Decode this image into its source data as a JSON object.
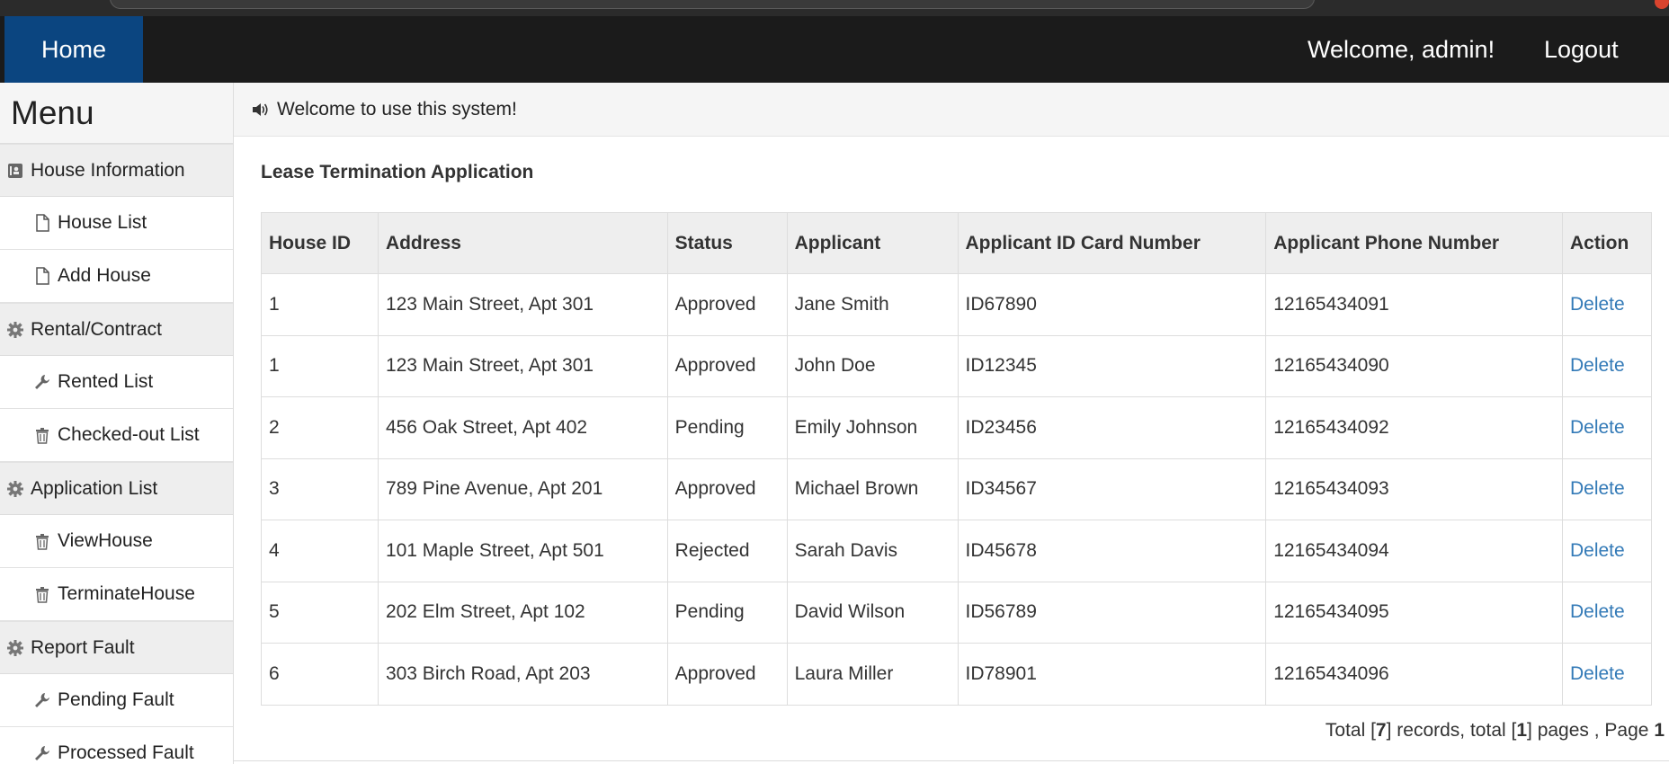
{
  "nav": {
    "home_label": "Home",
    "welcome_text": "Welcome, admin!",
    "logout_label": "Logout"
  },
  "sidebar": {
    "title": "Menu",
    "groups": [
      {
        "label": "House Information",
        "icon": "address-card-icon",
        "items": [
          {
            "label": "House List",
            "icon": "file-icon"
          },
          {
            "label": "Add House",
            "icon": "file-icon"
          }
        ]
      },
      {
        "label": "Rental/Contract",
        "icon": "gear-icon",
        "items": [
          {
            "label": "Rented List",
            "icon": "wrench-icon"
          },
          {
            "label": "Checked-out List",
            "icon": "trash-icon"
          }
        ]
      },
      {
        "label": "Application List",
        "icon": "gear-icon",
        "items": [
          {
            "label": "ViewHouse",
            "icon": "trash-icon"
          },
          {
            "label": "TerminateHouse",
            "icon": "trash-icon"
          }
        ]
      },
      {
        "label": "Report Fault",
        "icon": "gear-icon",
        "items": [
          {
            "label": "Pending Fault",
            "icon": "wrench-icon"
          },
          {
            "label": "Processed Fault",
            "icon": "wrench-icon"
          }
        ]
      }
    ]
  },
  "notice": {
    "text": "Welcome to use this system!",
    "icon": "speaker-icon"
  },
  "main": {
    "title": "Lease Termination Application",
    "columns": [
      "House ID",
      "Address",
      "Status",
      "Applicant",
      "Applicant ID Card Number",
      "Applicant Phone Number",
      "Action"
    ],
    "rows": [
      {
        "house_id": "1",
        "address": "123 Main Street, Apt 301",
        "status": "Approved",
        "applicant": "Jane Smith",
        "id_card": "ID67890",
        "phone": "12165434091",
        "action": "Delete"
      },
      {
        "house_id": "1",
        "address": "123 Main Street, Apt 301",
        "status": "Approved",
        "applicant": "John Doe",
        "id_card": "ID12345",
        "phone": "12165434090",
        "action": "Delete"
      },
      {
        "house_id": "2",
        "address": "456 Oak Street, Apt 402",
        "status": "Pending",
        "applicant": "Emily Johnson",
        "id_card": "ID23456",
        "phone": "12165434092",
        "action": "Delete"
      },
      {
        "house_id": "3",
        "address": "789 Pine Avenue, Apt 201",
        "status": "Approved",
        "applicant": "Michael Brown",
        "id_card": "ID34567",
        "phone": "12165434093",
        "action": "Delete"
      },
      {
        "house_id": "4",
        "address": "101 Maple Street, Apt 501",
        "status": "Rejected",
        "applicant": "Sarah Davis",
        "id_card": "ID45678",
        "phone": "12165434094",
        "action": "Delete"
      },
      {
        "house_id": "5",
        "address": "202 Elm Street, Apt 102",
        "status": "Pending",
        "applicant": "David Wilson",
        "id_card": "ID56789",
        "phone": "12165434095",
        "action": "Delete"
      },
      {
        "house_id": "6",
        "address": "303 Birch Road, Apt 203",
        "status": "Approved",
        "applicant": "Laura Miller",
        "id_card": "ID78901",
        "phone": "12165434096",
        "action": "Delete"
      }
    ]
  },
  "pager": {
    "prefix": "Total [",
    "records": "7",
    "mid1": "] records, total [",
    "pages": "1",
    "mid2": "] pages , Page ",
    "current_page": "1"
  },
  "colors": {
    "navbar": "#1b1b1b",
    "home_active": "#0b4580",
    "link": "#337ab7"
  }
}
